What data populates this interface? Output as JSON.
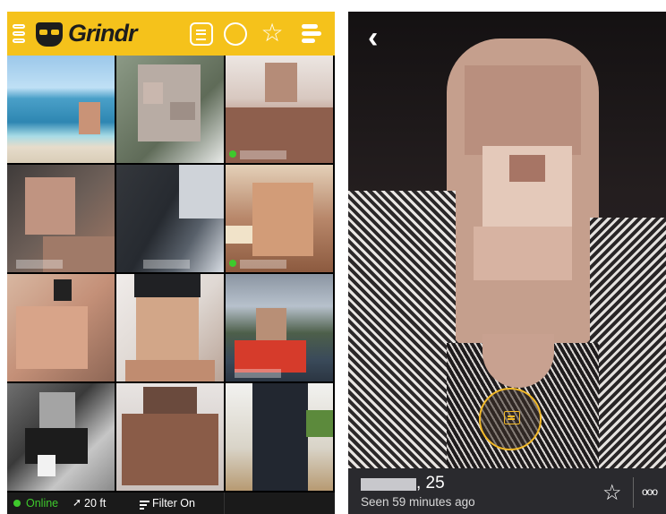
{
  "app": {
    "name": "Grindr"
  },
  "header": {
    "icons": [
      "menu-icon",
      "chat-icon",
      "circle-icon",
      "star-icon",
      "filter-bars-icon"
    ]
  },
  "grid": {
    "cells": [
      {
        "online": false
      },
      {
        "online": false
      },
      {
        "online": true
      },
      {
        "online": false
      },
      {
        "online": false
      },
      {
        "online": true
      },
      {
        "online": false
      },
      {
        "online": false
      },
      {
        "online": false
      },
      {
        "online": false
      },
      {
        "online": false
      },
      {
        "online": false
      }
    ]
  },
  "footer": {
    "online_label": "Online",
    "distance": "20 ft",
    "filter_label": "Filter On"
  },
  "profile": {
    "age": ", 25",
    "last_seen": "Seen 59 minutes ago",
    "more_label": "ooo"
  },
  "colors": {
    "brand_yellow": "#f5c21b",
    "online_green": "#3ec92c",
    "chat_ring": "#f2b928"
  }
}
